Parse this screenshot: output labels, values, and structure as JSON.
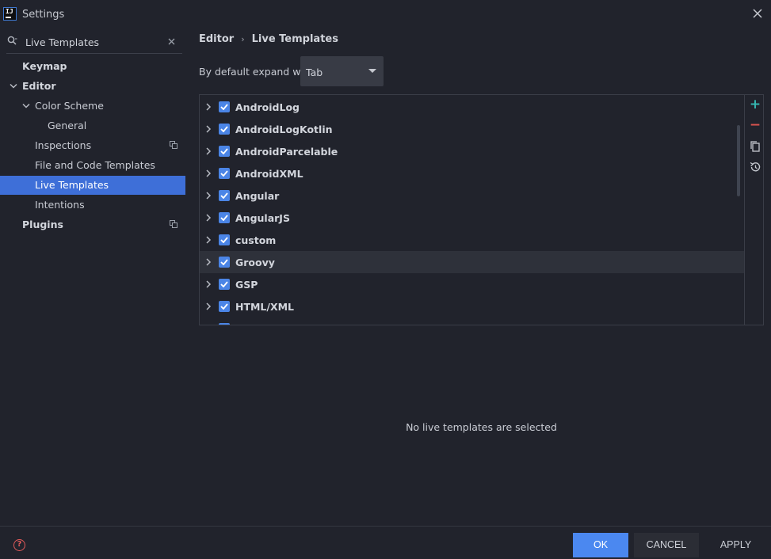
{
  "window": {
    "title": "Settings",
    "logo_text": "IJ"
  },
  "search": {
    "value": "Live Templates"
  },
  "sidebar": {
    "items": [
      {
        "label": "Keymap"
      },
      {
        "label": "Editor"
      },
      {
        "label": "Color Scheme"
      },
      {
        "label": "General"
      },
      {
        "label": "Inspections"
      },
      {
        "label": "File and Code Templates"
      },
      {
        "label": "Live Templates"
      },
      {
        "label": "Intentions"
      },
      {
        "label": "Plugins"
      }
    ]
  },
  "breadcrumb": {
    "parent": "Editor",
    "current": "Live Templates"
  },
  "expand": {
    "label": "By default expand with",
    "value": "Tab"
  },
  "templates": [
    {
      "name": "AndroidLog"
    },
    {
      "name": "AndroidLogKotlin"
    },
    {
      "name": "AndroidParcelable"
    },
    {
      "name": "AndroidXML"
    },
    {
      "name": "Angular"
    },
    {
      "name": "AngularJS"
    },
    {
      "name": "custom"
    },
    {
      "name": "Groovy"
    },
    {
      "name": "GSP"
    },
    {
      "name": "HTML/XML"
    }
  ],
  "empty_message": "No live templates are selected",
  "footer": {
    "ok": "OK",
    "cancel": "CANCEL",
    "apply": "APPLY"
  },
  "colors": {
    "accent": "#4b88f0",
    "selection": "#3e6fd8",
    "background": "#21232c",
    "add": "#35b5b0",
    "remove": "#d9534f"
  }
}
